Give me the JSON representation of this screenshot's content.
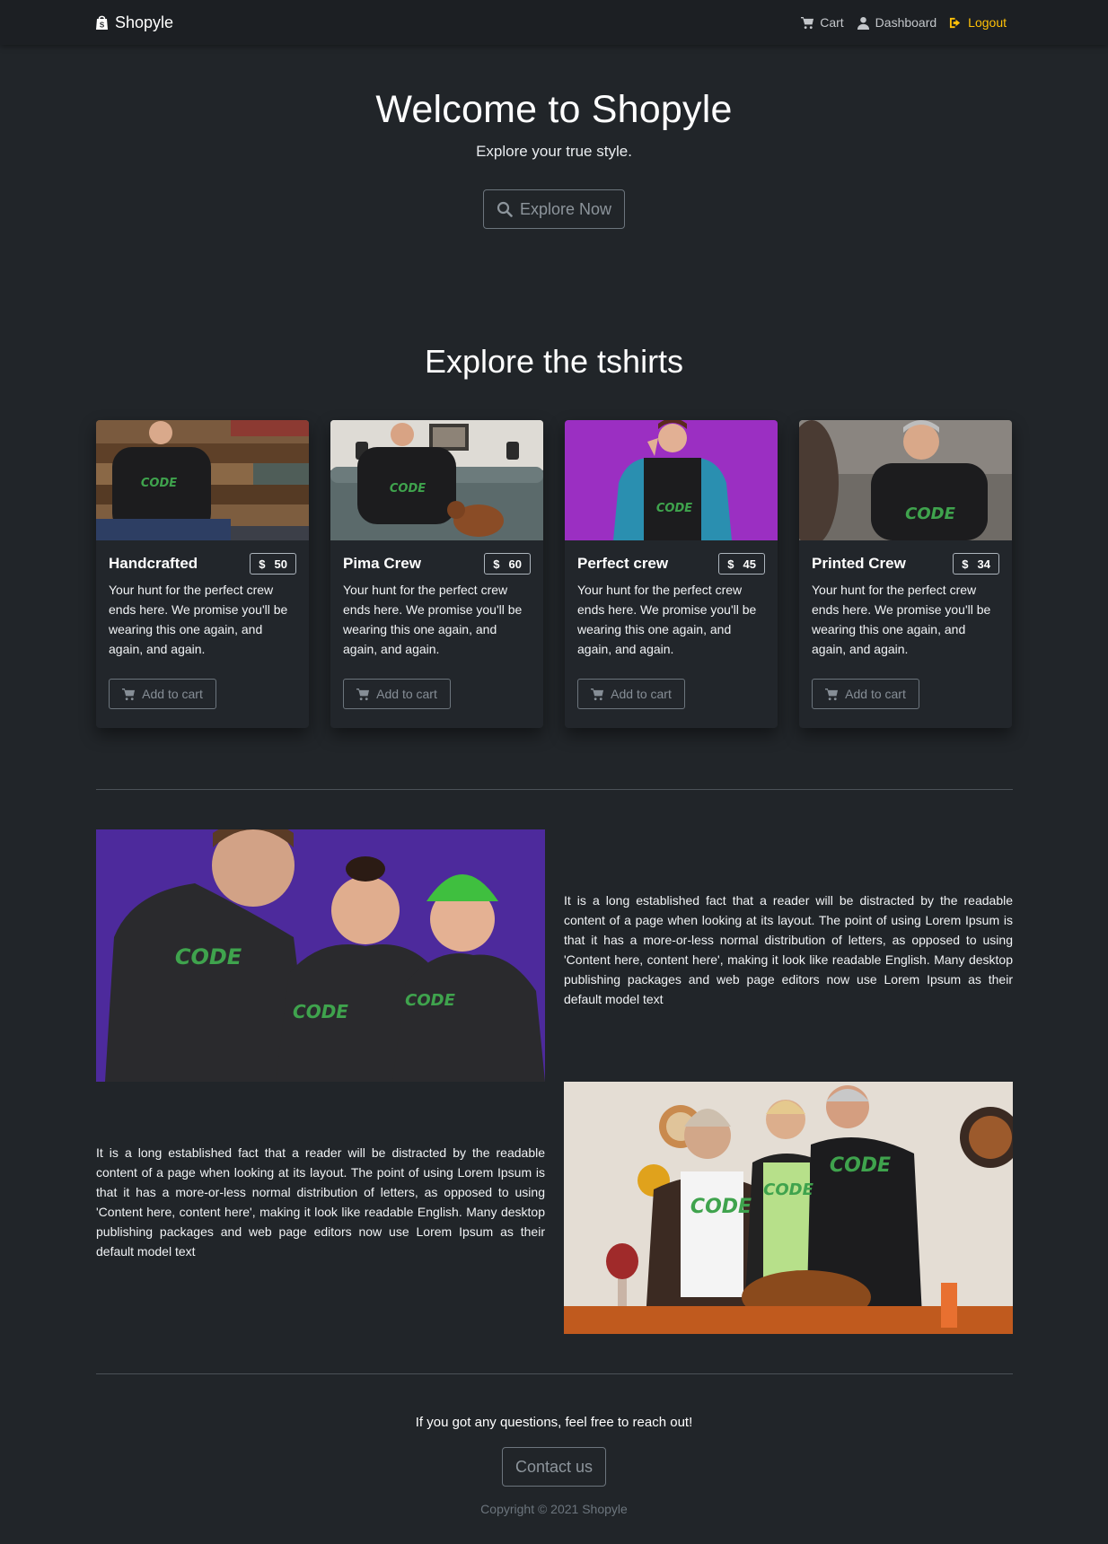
{
  "nav": {
    "brand": "Shopyle",
    "links": [
      {
        "label": "Cart",
        "icon": "cart-icon"
      },
      {
        "label": "Dashboard",
        "icon": "user-icon"
      },
      {
        "label": "Logout",
        "icon": "logout-icon"
      }
    ]
  },
  "hero": {
    "title": "Welcome to Shopyle",
    "subtitle": "Explore your true style.",
    "button": "Explore Now"
  },
  "products_section": {
    "title": "Explore the tshirts"
  },
  "products": [
    {
      "name": "Handcrafted",
      "currency": "$",
      "price": "50",
      "description": "Your hunt for the perfect crew ends here. We promise you'll be wearing this one again, and again, and again.",
      "button": "Add to cart"
    },
    {
      "name": "Pima Crew",
      "currency": "$",
      "price": "60",
      "description": "Your hunt for the perfect crew ends here. We promise you'll be wearing this one again, and again, and again.",
      "button": "Add to cart"
    },
    {
      "name": "Perfect crew",
      "currency": "$",
      "price": "45",
      "description": "Your hunt for the perfect crew ends here. We promise you'll be wearing this one again, and again, and again.",
      "button": "Add to cart"
    },
    {
      "name": "Printed Crew",
      "currency": "$",
      "price": "34",
      "description": "Your hunt for the perfect crew ends here. We promise you'll be wearing this one again, and again, and again.",
      "button": "Add to cart"
    }
  ],
  "features": [
    {
      "text": "It is a long established fact that a reader will be distracted by the readable content of a page when looking at its layout. The point of using Lorem Ipsum is that it has a more-or-less normal distribution of letters, as opposed to using 'Content here, content here', making it look like readable English. Many desktop publishing packages and web page editors now use Lorem Ipsum as their default model text"
    },
    {
      "text": "It is a long established fact that a reader will be distracted by the readable content of a page when looking at its layout. The point of using Lorem Ipsum is that it has a more-or-less normal distribution of letters, as opposed to using 'Content here, content here', making it look like readable English. Many desktop publishing packages and web page editors now use Lorem Ipsum as their default model text"
    }
  ],
  "footer": {
    "question": "If you got any questions, feel free to reach out!",
    "button": "Contact us",
    "copyright": "Copyright © 2021 Shopyle"
  },
  "colors": {
    "background": "#212529",
    "navbar": "#1c1f23",
    "accent": "#ffc107",
    "print_green": "#3fa34d"
  }
}
